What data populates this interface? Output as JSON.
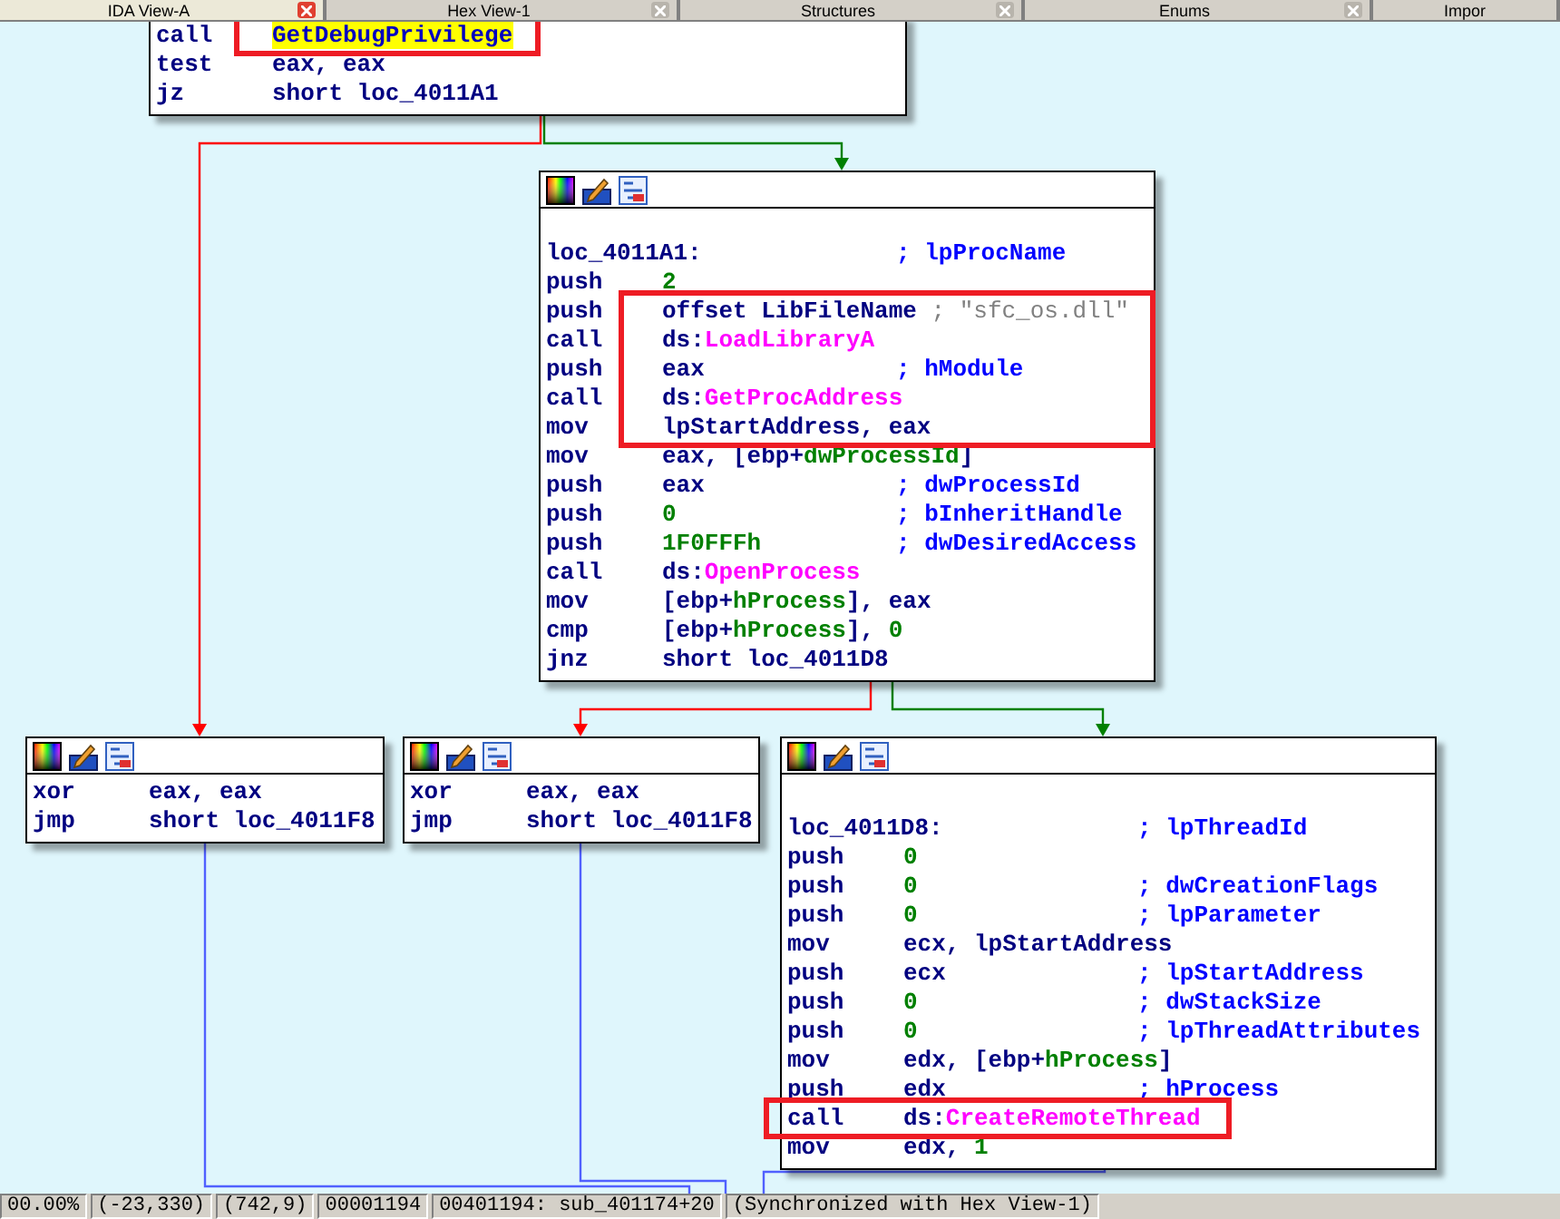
{
  "tabs": [
    {
      "label": "IDA View-A",
      "selected": true
    },
    {
      "label": "Hex View-1",
      "selected": false
    },
    {
      "label": "Structures",
      "selected": false
    },
    {
      "label": "Enums",
      "selected": false
    },
    {
      "label": "Impor",
      "selected": false
    }
  ],
  "nodes": [
    {
      "kind": "partial",
      "lines": [
        {
          "kind": "insn",
          "mnemonic": "call",
          "operand": [
            {
              "text": "GetDebugPrivilege",
              "kind": "highlighted"
            }
          ],
          "framed": true
        },
        {
          "kind": "insn",
          "mnemonic": "test",
          "operand": [
            {
              "text": "eax, eax",
              "kind": "plain"
            }
          ],
          "framed": false
        },
        {
          "kind": "insn",
          "mnemonic": "jz",
          "operand": [
            {
              "text": "short loc_4011A1",
              "kind": "plain"
            }
          ],
          "framed": false
        }
      ]
    },
    {
      "kind": "block",
      "lines": [
        {
          "kind": "label",
          "label": "loc_4011A1:",
          "comment": "; lpProcName",
          "framed": false
        },
        {
          "kind": "insn",
          "mnemonic": "push",
          "operand": [
            {
              "text": "2",
              "kind": "number"
            }
          ],
          "framed": false
        },
        {
          "kind": "insn",
          "mnemonic": "push",
          "operand": [
            {
              "text": "offset LibFileName ",
              "kind": "plain"
            },
            {
              "text": "; \"sfc_os.dll\"",
              "kind": "string"
            }
          ],
          "framed": true
        },
        {
          "kind": "insn",
          "mnemonic": "call",
          "operand": [
            {
              "text": "ds:",
              "kind": "plain"
            },
            {
              "text": "LoadLibraryA",
              "kind": "import"
            }
          ],
          "framed": true
        },
        {
          "kind": "insn",
          "mnemonic": "push",
          "operand": [
            {
              "text": "eax",
              "kind": "plain"
            }
          ],
          "comment": "; hModule",
          "framed": true
        },
        {
          "kind": "insn",
          "mnemonic": "call",
          "operand": [
            {
              "text": "ds:",
              "kind": "plain"
            },
            {
              "text": "GetProcAddress",
              "kind": "import"
            }
          ],
          "framed": true
        },
        {
          "kind": "insn",
          "mnemonic": "mov",
          "operand": [
            {
              "text": "lpStartAddress, eax",
              "kind": "plain"
            }
          ],
          "framed": true
        },
        {
          "kind": "insn",
          "mnemonic": "mov",
          "operand": [
            {
              "text": "eax, [ebp+",
              "kind": "plain"
            },
            {
              "text": "dwProcessId",
              "kind": "var"
            },
            {
              "text": "]",
              "kind": "plain"
            }
          ],
          "framed": false
        },
        {
          "kind": "insn",
          "mnemonic": "push",
          "operand": [
            {
              "text": "eax",
              "kind": "plain"
            }
          ],
          "comment": "; dwProcessId",
          "framed": false
        },
        {
          "kind": "insn",
          "mnemonic": "push",
          "operand": [
            {
              "text": "0",
              "kind": "number"
            }
          ],
          "comment": "; bInheritHandle",
          "framed": false
        },
        {
          "kind": "insn",
          "mnemonic": "push",
          "operand": [
            {
              "text": "1F0FFFh",
              "kind": "number"
            }
          ],
          "comment": "; dwDesiredAccess",
          "framed": false
        },
        {
          "kind": "insn",
          "mnemonic": "call",
          "operand": [
            {
              "text": "ds:",
              "kind": "plain"
            },
            {
              "text": "OpenProcess",
              "kind": "import"
            }
          ],
          "framed": false
        },
        {
          "kind": "insn",
          "mnemonic": "mov",
          "operand": [
            {
              "text": "[ebp+",
              "kind": "plain"
            },
            {
              "text": "hProcess",
              "kind": "var"
            },
            {
              "text": "], eax",
              "kind": "plain"
            }
          ],
          "framed": false
        },
        {
          "kind": "insn",
          "mnemonic": "cmp",
          "operand": [
            {
              "text": "[ebp+",
              "kind": "plain"
            },
            {
              "text": "hProcess",
              "kind": "var"
            },
            {
              "text": "], ",
              "kind": "plain"
            },
            {
              "text": "0",
              "kind": "number"
            }
          ],
          "framed": false
        },
        {
          "kind": "insn",
          "mnemonic": "jnz",
          "operand": [
            {
              "text": "short loc_4011D8",
              "kind": "plain"
            }
          ],
          "framed": false
        }
      ]
    },
    {
      "kind": "block",
      "lines": [
        {
          "kind": "insn",
          "mnemonic": "xor",
          "operand": [
            {
              "text": "eax, eax",
              "kind": "plain"
            }
          ],
          "framed": false
        },
        {
          "kind": "insn",
          "mnemonic": "jmp",
          "operand": [
            {
              "text": "short loc_4011F8",
              "kind": "plain"
            }
          ],
          "framed": false
        }
      ]
    },
    {
      "kind": "block",
      "lines": [
        {
          "kind": "insn",
          "mnemonic": "xor",
          "operand": [
            {
              "text": "eax, eax",
              "kind": "plain"
            }
          ],
          "framed": false
        },
        {
          "kind": "insn",
          "mnemonic": "jmp",
          "operand": [
            {
              "text": "short loc_4011F8",
              "kind": "plain"
            }
          ],
          "framed": false
        }
      ]
    },
    {
      "kind": "block",
      "lines": [
        {
          "kind": "label",
          "label": "loc_4011D8:",
          "comment": "; lpThreadId",
          "framed": false
        },
        {
          "kind": "insn",
          "mnemonic": "push",
          "operand": [
            {
              "text": "0",
              "kind": "number"
            }
          ],
          "framed": false
        },
        {
          "kind": "insn",
          "mnemonic": "push",
          "operand": [
            {
              "text": "0",
              "kind": "number"
            }
          ],
          "comment": "; dwCreationFlags",
          "framed": false
        },
        {
          "kind": "insn",
          "mnemonic": "push",
          "operand": [
            {
              "text": "0",
              "kind": "number"
            }
          ],
          "comment": "; lpParameter",
          "framed": false
        },
        {
          "kind": "insn",
          "mnemonic": "mov",
          "operand": [
            {
              "text": "ecx, lpStartAddress",
              "kind": "plain"
            }
          ],
          "framed": false
        },
        {
          "kind": "insn",
          "mnemonic": "push",
          "operand": [
            {
              "text": "ecx",
              "kind": "plain"
            }
          ],
          "comment": "; lpStartAddress",
          "framed": false
        },
        {
          "kind": "insn",
          "mnemonic": "push",
          "operand": [
            {
              "text": "0",
              "kind": "number"
            }
          ],
          "comment": "; dwStackSize",
          "framed": false
        },
        {
          "kind": "insn",
          "mnemonic": "push",
          "operand": [
            {
              "text": "0",
              "kind": "number"
            }
          ],
          "comment": "; lpThreadAttributes",
          "framed": false
        },
        {
          "kind": "insn",
          "mnemonic": "mov",
          "operand": [
            {
              "text": "edx, [ebp+",
              "kind": "plain"
            },
            {
              "text": "hProcess",
              "kind": "var"
            },
            {
              "text": "]",
              "kind": "plain"
            }
          ],
          "framed": false
        },
        {
          "kind": "insn",
          "mnemonic": "push",
          "operand": [
            {
              "text": "edx",
              "kind": "plain"
            }
          ],
          "comment": "; hProcess",
          "framed": false
        },
        {
          "kind": "insn",
          "mnemonic": "call",
          "operand": [
            {
              "text": "ds:",
              "kind": "plain"
            },
            {
              "text": "CreateRemoteThread",
              "kind": "import"
            }
          ],
          "framed": true
        },
        {
          "kind": "insn",
          "mnemonic": "mov",
          "operand": [
            {
              "text": "edx, ",
              "kind": "plain"
            },
            {
              "text": "1",
              "kind": "number"
            }
          ],
          "framed": false
        }
      ]
    }
  ],
  "edges": [
    {
      "kind": "false"
    },
    {
      "kind": "true"
    },
    {
      "kind": "false"
    },
    {
      "kind": "true"
    },
    {
      "kind": "jump"
    },
    {
      "kind": "jump"
    },
    {
      "kind": "jump"
    }
  ],
  "status_bar": [
    "00.00%",
    "(-23,330)",
    "(742,9)",
    "00001194",
    "00401194: sub_401174+20",
    "(Synchronized with Hex View-1)"
  ]
}
